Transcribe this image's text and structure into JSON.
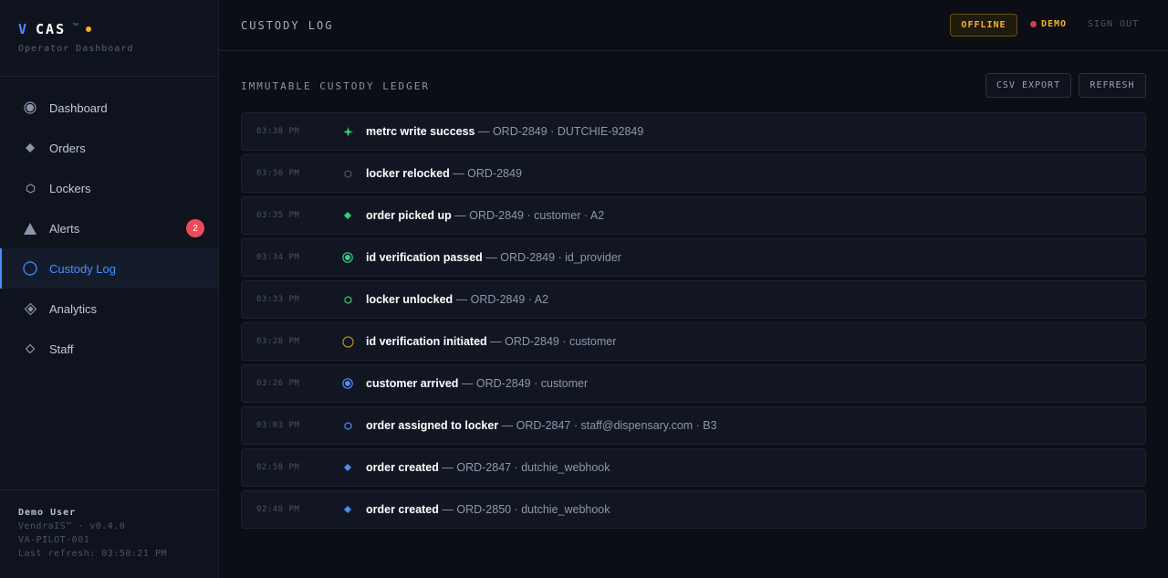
{
  "brand": {
    "v": "V",
    "name": "CAS",
    "tm": "™",
    "subtitle": "Operator Dashboard"
  },
  "nav": [
    {
      "label": "Dashboard",
      "icon": "dashboard-icon"
    },
    {
      "label": "Orders",
      "icon": "diamond-icon"
    },
    {
      "label": "Lockers",
      "icon": "hexagon-icon"
    },
    {
      "label": "Alerts",
      "icon": "triangle-icon",
      "badge": "2"
    },
    {
      "label": "Custody Log",
      "icon": "circle-icon",
      "active": true
    },
    {
      "label": "Analytics",
      "icon": "diamond-outline-icon"
    },
    {
      "label": "Staff",
      "icon": "diamond-small-icon"
    }
  ],
  "footer": {
    "user": "Demo User",
    "version": "VendraIS™ · v0.4.0",
    "pilot": "VA-PILOT-001",
    "refresh": "Last refresh: 03:50:21 PM"
  },
  "header": {
    "title": "CUSTODY LOG",
    "status": "OFFLINE",
    "mode": "DEMO",
    "signout": "SIGN OUT"
  },
  "main": {
    "section_title": "IMMUTABLE CUSTODY LEDGER",
    "csv_label": "CSV EXPORT",
    "refresh_label": "REFRESH"
  },
  "log": [
    {
      "time": "03:38 PM",
      "event": "metrc write success",
      "detail": " — ORD-2849 · DUTCHIE-92849",
      "icon": "sparkle-icon",
      "color": "#2ed47a"
    },
    {
      "time": "03:36 PM",
      "event": "locker relocked",
      "detail": " — ORD-2849",
      "icon": "hexagon-icon",
      "color": "#4a5367"
    },
    {
      "time": "03:35 PM",
      "event": "order picked up",
      "detail": " — ORD-2849 · customer · A2",
      "icon": "diamond-icon",
      "color": "#2ed47a"
    },
    {
      "time": "03:34 PM",
      "event": "id verification passed",
      "detail": " — ORD-2849 · id_provider",
      "icon": "target-icon",
      "color": "#2ed47a"
    },
    {
      "time": "03:33 PM",
      "event": "locker unlocked",
      "detail": " — ORD-2849 · A2",
      "icon": "hexagon-icon",
      "color": "#2ed47a"
    },
    {
      "time": "03:28 PM",
      "event": "id verification initiated",
      "detail": " — ORD-2849 · customer",
      "icon": "circle-icon",
      "color": "#c9901f"
    },
    {
      "time": "03:26 PM",
      "event": "customer arrived",
      "detail": " — ORD-2849 · customer",
      "icon": "target-icon",
      "color": "#4b8dff"
    },
    {
      "time": "03:03 PM",
      "event": "order assigned to locker",
      "detail": " — ORD-2847 · staff@dispensary.com · B3",
      "icon": "hexagon-icon",
      "color": "#4b8dff"
    },
    {
      "time": "02:58 PM",
      "event": "order created",
      "detail": " — ORD-2847 · dutchie_webhook",
      "icon": "diamond-icon",
      "color": "#4b8dff"
    },
    {
      "time": "02:48 PM",
      "event": "order created",
      "detail": " — ORD-2850 · dutchie_webhook",
      "icon": "diamond-icon",
      "color": "#4b8dff"
    }
  ]
}
